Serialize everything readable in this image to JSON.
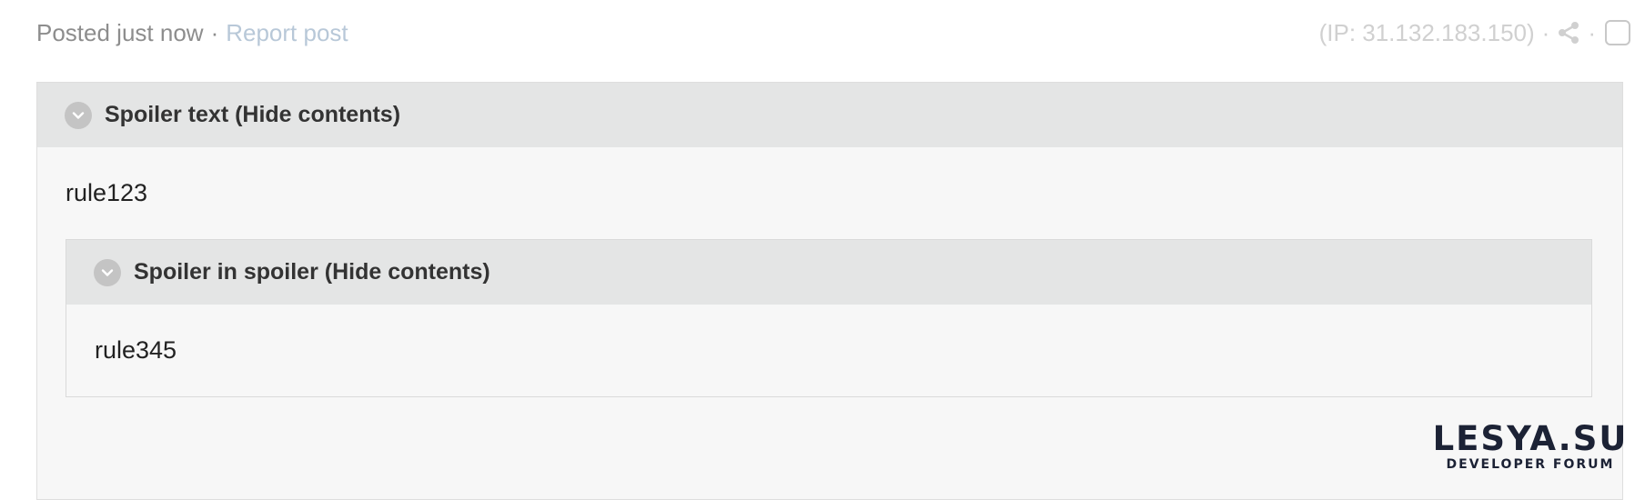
{
  "post_meta": {
    "posted": "Posted just now",
    "separator": "·",
    "report_label": "Report post",
    "ip_text": "(IP: 31.132.183.150)",
    "dot": "·"
  },
  "icons": {
    "share": "share-icon",
    "toggle": "chevron-down-circle-icon",
    "checkbox": "checkbox-icon"
  },
  "spoiler": {
    "title": "Spoiler text (Hide contents)",
    "content": "rule123",
    "inner": {
      "title": "Spoiler in spoiler (Hide contents)",
      "content": "rule345"
    }
  },
  "watermark": {
    "brand": "LESYA.SU",
    "tagline": "DEVELOPER FORUM"
  },
  "colors": {
    "header_bg": "#e4e5e5",
    "body_bg": "#f7f7f7",
    "link": "#b8c8d8",
    "muted": "#8d8d8d"
  }
}
